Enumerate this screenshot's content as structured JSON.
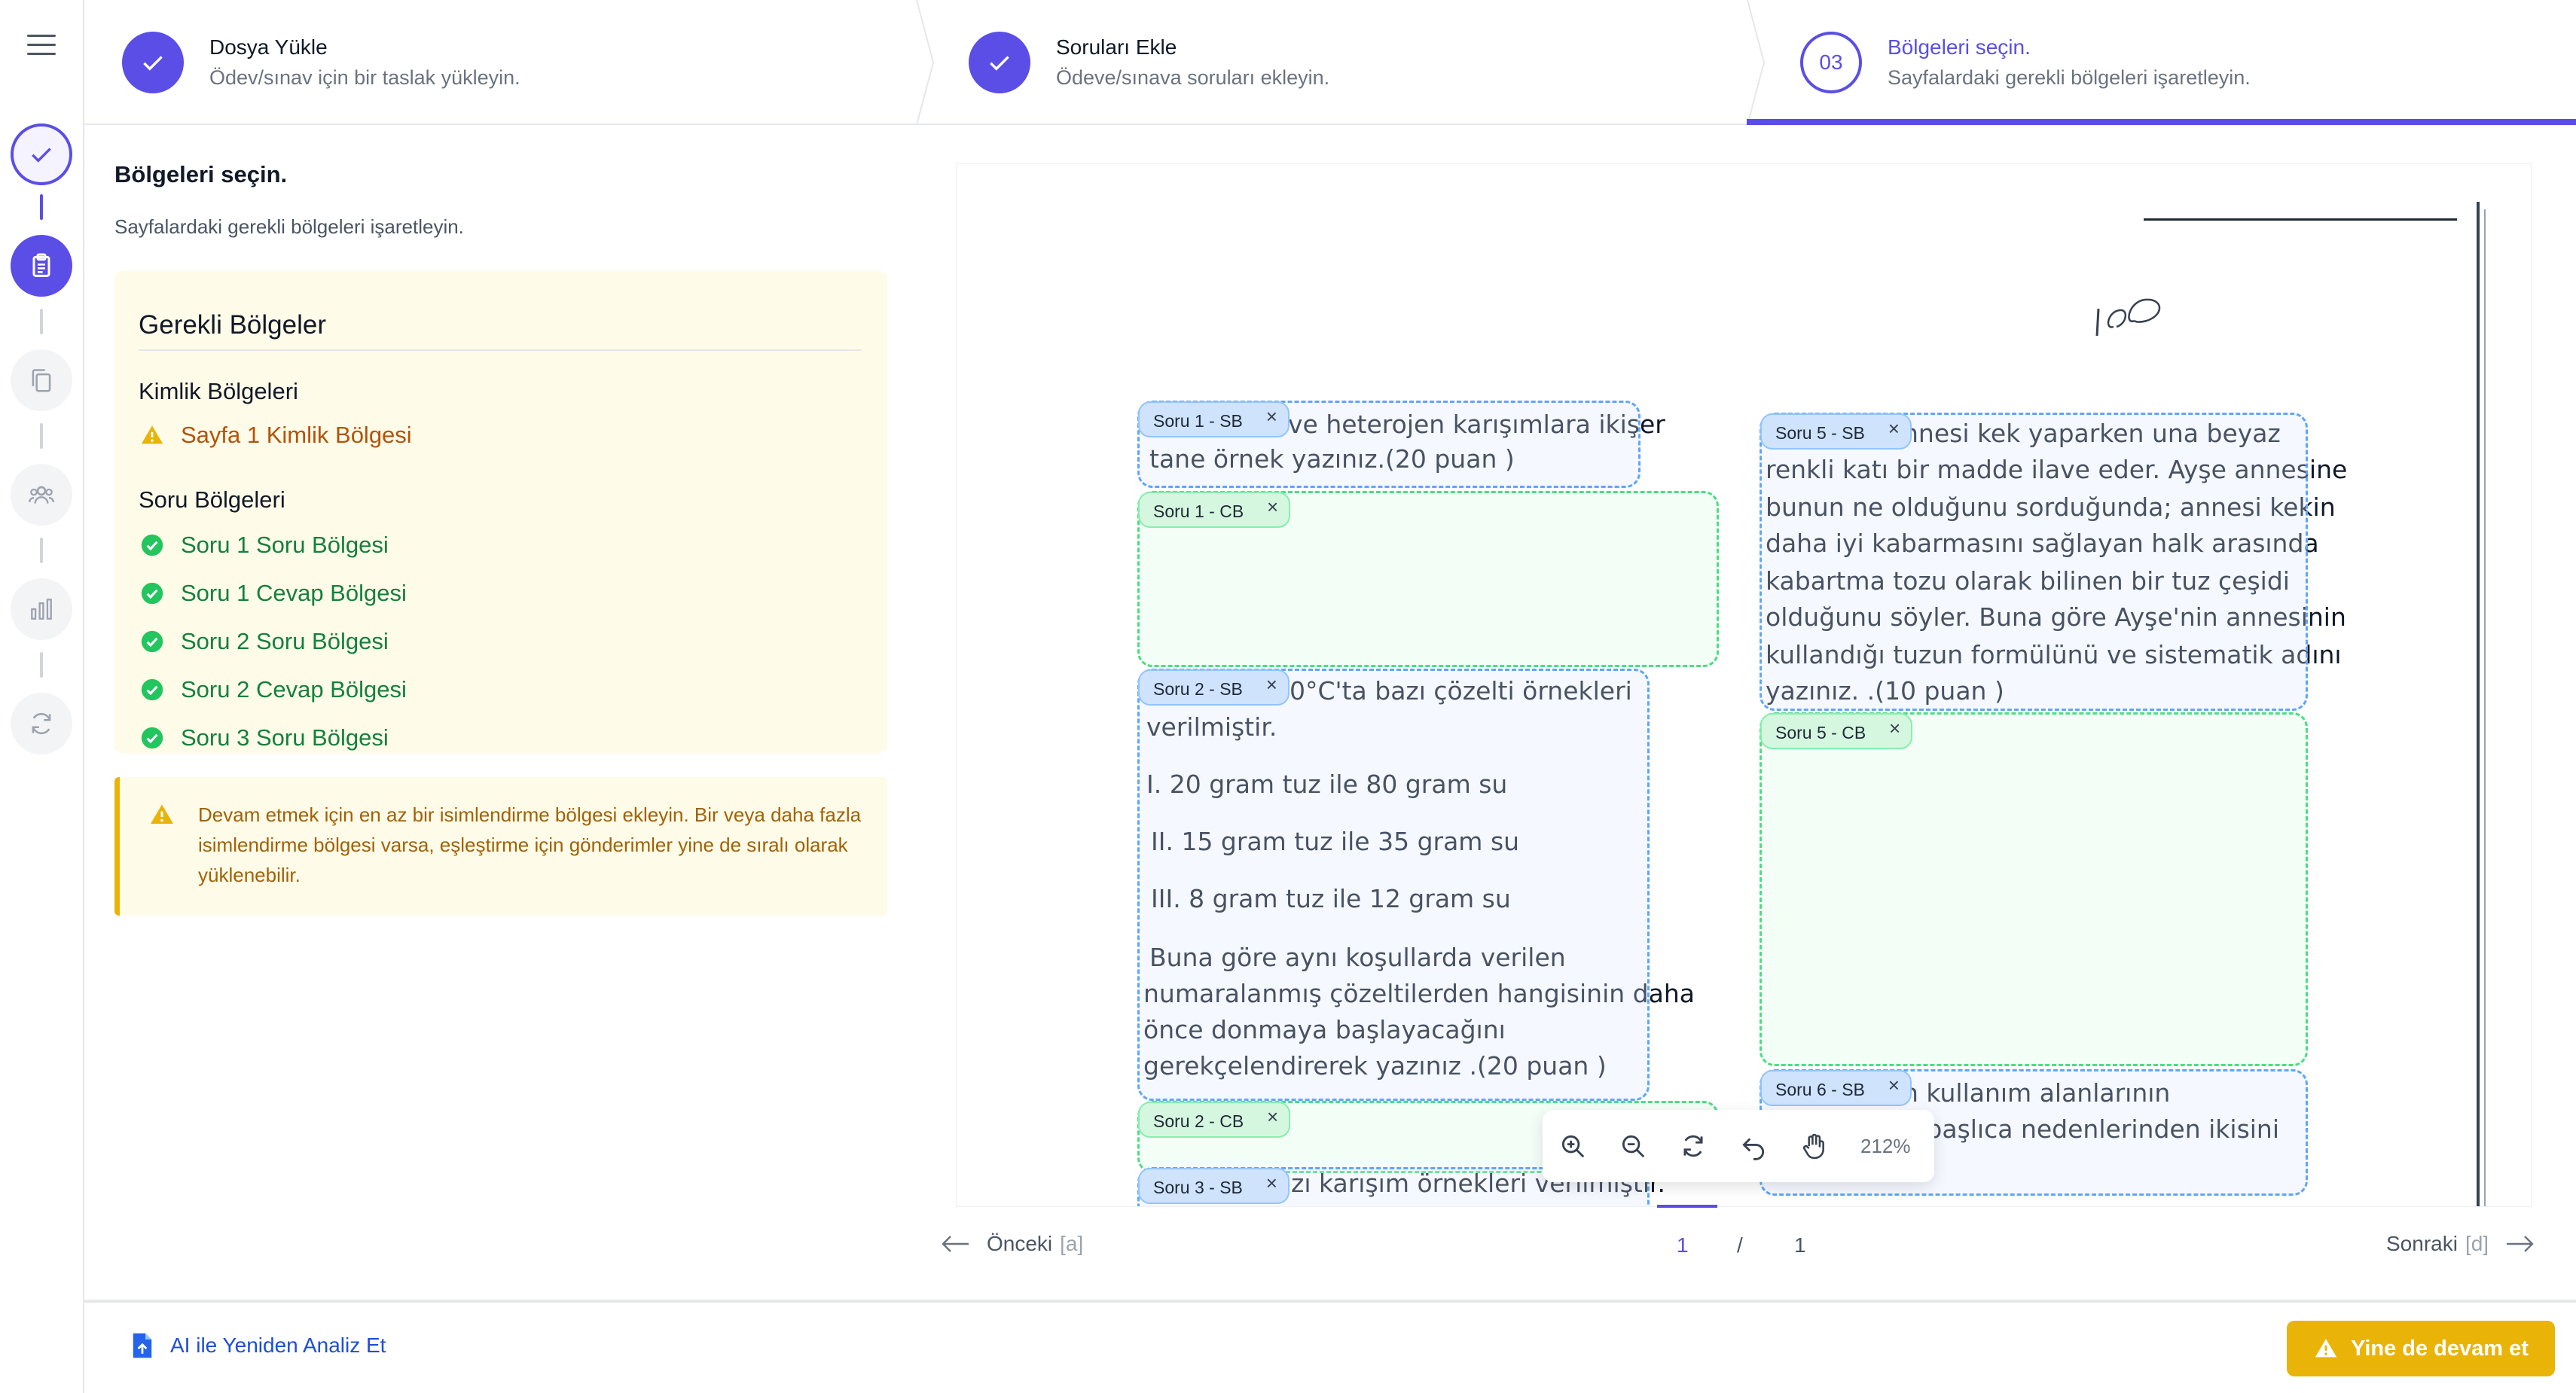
{
  "stepper": {
    "steps": [
      {
        "title": "Dosya Yükle",
        "subtitle": "Ödev/sınav için bir taslak yükleyin.",
        "state": "done"
      },
      {
        "title": "Soruları Ekle",
        "subtitle": "Ödeve/sınava soruları ekleyin.",
        "state": "done"
      },
      {
        "number": "03",
        "title": "Bölgeleri seçin.",
        "subtitle": "Sayfalardaki gerekli bölgeleri işaretleyin.",
        "state": "current"
      }
    ]
  },
  "rail": {
    "items": [
      {
        "icon": "check-icon",
        "state": "done"
      },
      {
        "icon": "clipboard-icon",
        "state": "active"
      },
      {
        "icon": "copy-icon",
        "state": "idle"
      },
      {
        "icon": "users-icon",
        "state": "idle"
      },
      {
        "icon": "bar-chart-icon",
        "state": "idle"
      },
      {
        "icon": "refresh-icon",
        "state": "idle"
      }
    ]
  },
  "panel": {
    "title": "Bölgeleri seçin.",
    "subtitle": "Sayfalardaki gerekli bölgeleri işaretleyin.",
    "required_heading": "Gerekli Bölgeler",
    "identity_heading": "Kimlik Bölgeleri",
    "identity_items": [
      "Sayfa 1 Kimlik Bölgesi"
    ],
    "question_heading": "Soru Bölgeleri",
    "question_items": [
      "Soru 1 Soru Bölgesi",
      "Soru 1 Cevap Bölgesi",
      "Soru 2 Soru Bölgesi",
      "Soru 2 Cevap Bölgesi",
      "Soru 3 Soru Bölgesi"
    ]
  },
  "alert": {
    "text": "Devam etmek için en az bir isimlendirme bölgesi ekleyin. Bir veya daha fazla isimlendirme bölgesi varsa, eşleştirme için gönderimler yine de sıralı olarak yüklenebilir."
  },
  "document": {
    "handwritten_score": "100",
    "lines": [
      "ve heterojen karışımlara ikişer",
      "tane örnek yazınız.(20 puan )",
      "0°C'ta bazı çözelti örnekleri",
      "verilmiştir.",
      "I. 20 gram tuz ile 80 gram su",
      "II. 15 gram tuz ile 35 gram su",
      "III. 8 gram tuz ile 12 gram su",
      "Buna göre aynı koşullarda verilen",
      "numaralanmış çözeltilerden hangisinin daha",
      "önce donmaya başlayacağını",
      "gerekçelendirerek yazınız .(20 puan )",
      "zı karışım örnekleri verilmiştir.",
      "nnesi kek yaparken una beyaz",
      "renkli katı bir madde ilave eder. Ayşe annesine",
      "bunun ne olduğunu sorduğunda; annesi kekin",
      "daha iyi kabarmasını sağlayan halk arasında",
      "kabartma tozu olarak bilinen bir tuz çeşidi",
      "olduğunu söyler. Buna göre Ayşe'nin annesinin",
      "kullandığı tuzun formülünü ve sistematik adını",
      "yazınız. .(10 puan )",
      "n kullanım alanlarının",
      "n başlıca nedenlerinden ikisini",
      "n )"
    ],
    "regions": [
      {
        "label": "Soru 1 - SB",
        "kind": "sb"
      },
      {
        "label": "Soru 1 - CB",
        "kind": "cb"
      },
      {
        "label": "Soru 2 - SB",
        "kind": "sb"
      },
      {
        "label": "Soru 2 - CB",
        "kind": "cb"
      },
      {
        "label": "Soru 3 - SB",
        "kind": "sb"
      },
      {
        "label": "Soru 5 - SB",
        "kind": "sb"
      },
      {
        "label": "Soru 5 - CB",
        "kind": "cb"
      },
      {
        "label": "Soru 6 - SB",
        "kind": "sb"
      }
    ],
    "remove_glyph": "×"
  },
  "zoom": {
    "level": "212%"
  },
  "pagination": {
    "prev_label": "Önceki",
    "prev_key": "[a]",
    "next_label": "Sonraki",
    "next_key": "[d]",
    "current": "1",
    "separator": "/",
    "total": "1"
  },
  "footer": {
    "reanalyze_label": "AI ile Yeniden Analiz Et",
    "continue_label": "Yine de devam et"
  },
  "colors": {
    "accent": "#5a4ee6",
    "success": "#15803d",
    "warning": "#b45309",
    "button": "#eab308"
  }
}
